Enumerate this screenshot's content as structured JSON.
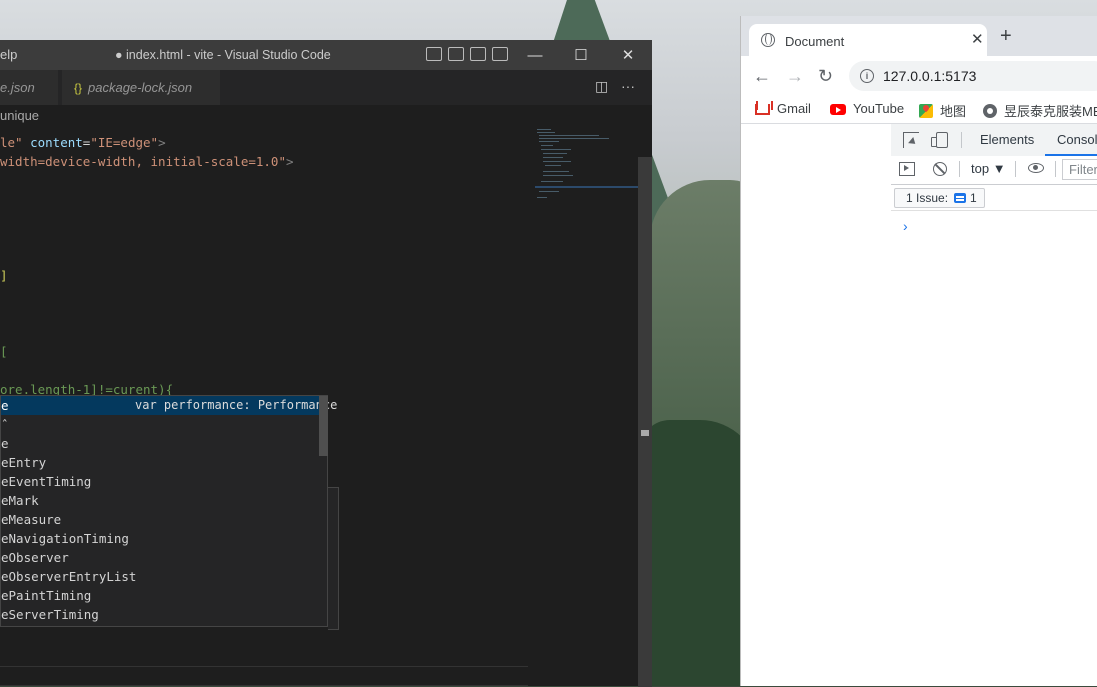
{
  "vscode": {
    "menu_fragment": "elp",
    "window_title": "● index.html - vite - Visual Studio Code",
    "tabs": [
      {
        "label": "e.json"
      },
      {
        "label": "package-lock.json"
      }
    ],
    "breadcrumb": "unique",
    "code": {
      "line1_attr": "le\"",
      "line1_name": "content",
      "line1_value": "\"IE=edge\"",
      "line2_value": "width=device-width, initial-scale=1.0\"",
      "line3": "]",
      "line4": "[",
      "line5": "ore.length-1]!=curent){"
    },
    "suggestions": [
      {
        "label": "e",
        "detail": "var performance: Performance"
      },
      {
        "label": "ˆ"
      },
      {
        "label": "e"
      },
      {
        "label": "eEntry"
      },
      {
        "label": "eEventTiming"
      },
      {
        "label": "eMark"
      },
      {
        "label": "eMeasure"
      },
      {
        "label": "eNavigationTiming"
      },
      {
        "label": "eObserver"
      },
      {
        "label": "eObserverEntryList"
      },
      {
        "label": "ePaintTiming"
      },
      {
        "label": "eServerTiming"
      }
    ]
  },
  "chrome": {
    "tab_title": "Document",
    "url": "127.0.0.1:5173",
    "bookmarks": [
      {
        "label": "Gmail",
        "icon": "gmail-icon"
      },
      {
        "label": "YouTube",
        "icon": "youtube-icon"
      },
      {
        "label": "地图",
        "icon": "maps-icon"
      },
      {
        "label": "昱辰泰克服装MES",
        "icon": "globe-icon"
      }
    ],
    "devtools": {
      "tabs": [
        {
          "label": "Elements"
        },
        {
          "label": "Consol"
        }
      ],
      "context": "top",
      "filter_placeholder": "Filter",
      "issues_label": "1 Issue:",
      "issues_count": "1",
      "prompt": "›"
    }
  },
  "colors": {
    "vscode_bg": "#1e1e1e",
    "suggest_selected": "#04395e",
    "chrome_accent": "#1a73e8"
  }
}
